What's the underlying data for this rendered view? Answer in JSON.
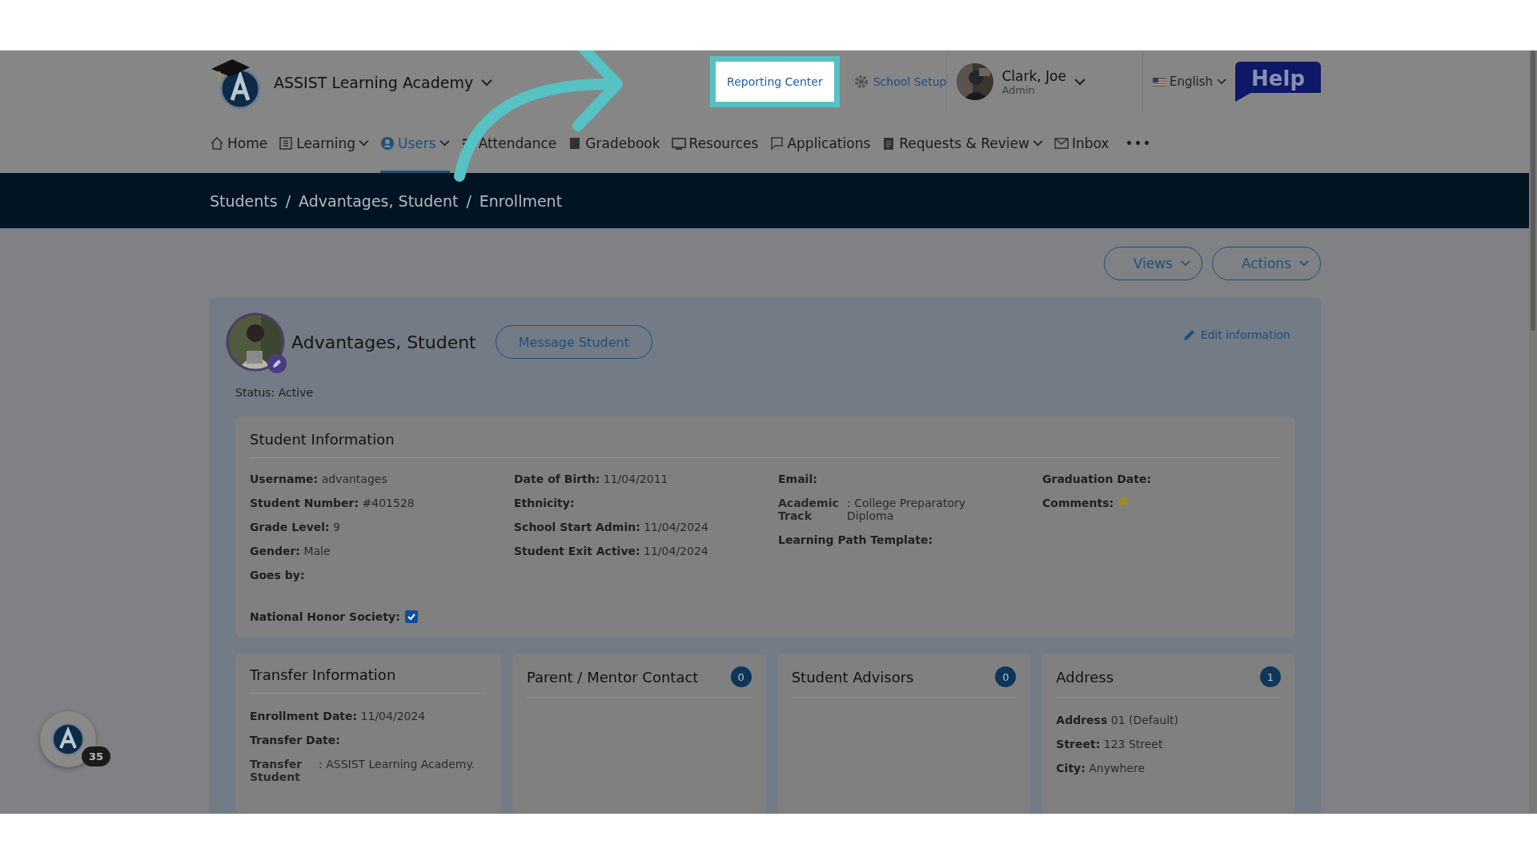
{
  "header": {
    "school_name": "ASSIST Learning Academy",
    "top_links": [
      {
        "label": "Reporting Center",
        "highlighted": true,
        "kind": "report"
      },
      {
        "label": "School Setup",
        "highlighted": false,
        "kind": "gear"
      }
    ],
    "user": {
      "name": "Clark, Joe",
      "role": "Admin"
    },
    "language": "English",
    "help": "Help"
  },
  "nav": {
    "items": [
      {
        "label": "Home",
        "selected": false,
        "dropdown": false,
        "kind": "home"
      },
      {
        "label": "Learning",
        "selected": false,
        "dropdown": true,
        "kind": "grid"
      },
      {
        "label": "Users",
        "selected": true,
        "dropdown": true,
        "kind": "user"
      },
      {
        "label": "Attendance",
        "selected": false,
        "dropdown": false,
        "kind": "lines"
      },
      {
        "label": "Gradebook",
        "selected": false,
        "dropdown": false,
        "kind": "book"
      },
      {
        "label": "Resources",
        "selected": false,
        "dropdown": false,
        "kind": "monitor"
      },
      {
        "label": "Applications",
        "selected": false,
        "dropdown": false,
        "kind": "chat"
      },
      {
        "label": "Requests & Review",
        "selected": false,
        "dropdown": true,
        "kind": "clipboard"
      },
      {
        "label": "Inbox",
        "selected": false,
        "dropdown": false,
        "kind": "mail"
      }
    ],
    "more": "•••"
  },
  "breadcrumb": [
    {
      "label": "Students"
    },
    {
      "separator": "/",
      "label": "Advantages, Student"
    },
    {
      "separator": "/",
      "label": "Enrollment"
    }
  ],
  "actions": [
    "Views",
    "Actions"
  ],
  "profile": {
    "name": "Advantages, Student",
    "message_button": "Message Student",
    "edit_link": "Edit information",
    "status": "Status: Active"
  },
  "student_info": {
    "title": "Student Information",
    "columns": [
      [
        {
          "label": "Username:",
          "value": "advantages",
          "kind": "text"
        },
        {
          "label": "Student Number:",
          "value": "#401528",
          "kind": "text"
        },
        {
          "label": "Grade Level:",
          "value": "9",
          "kind": "text"
        },
        {
          "label": "Gender:",
          "value": "Male",
          "kind": "text"
        },
        {
          "label": "Goes by:",
          "kind": "text"
        }
      ],
      [
        {
          "label": "Date of Birth:",
          "value": "11/04/2011",
          "kind": "text"
        },
        {
          "label": "Ethnicity:",
          "kind": "text"
        },
        {
          "label": "School Start Admin:",
          "value": "11/04/2024",
          "kind": "text"
        },
        {
          "label": "Student Exit Active:",
          "value": "11/04/2024",
          "kind": "text"
        }
      ],
      [
        {
          "label": "Email:",
          "kind": "text"
        },
        {
          "label": "Academic Track",
          "value": ": College Preparatory Diploma",
          "kind": "split"
        },
        {
          "label": "Learning Path Template:",
          "kind": "text"
        }
      ],
      [
        {
          "label": "Graduation Date:",
          "kind": "text"
        },
        {
          "label": "Comments:",
          "kind": "flag"
        }
      ]
    ],
    "national_honor_society": {
      "label": "National Honor Society:",
      "checked": true
    }
  },
  "cards": [
    {
      "title": "Transfer Information",
      "fields": [
        {
          "label": "Enrollment Date:",
          "value": "11/04/2024",
          "kind": "text"
        },
        {
          "label": "Transfer Date:",
          "kind": "text"
        },
        {
          "label": "Transfer Student",
          "value": ": ASSIST Learning Academy.",
          "kind": "split"
        }
      ]
    },
    {
      "title": "Parent / Mentor Contact",
      "count": "0"
    },
    {
      "title": "Student Advisors",
      "count": "0"
    },
    {
      "title": "Address",
      "count": "1",
      "fields": [
        {
          "label": "Address",
          "value": "01 (Default)",
          "kind": "text"
        },
        {
          "label": "Street:",
          "value": "123 Street",
          "kind": "text"
        },
        {
          "label": "City:",
          "value": "Anywhere",
          "kind": "text"
        }
      ]
    }
  ],
  "chat_widget": {
    "badge": "35"
  }
}
